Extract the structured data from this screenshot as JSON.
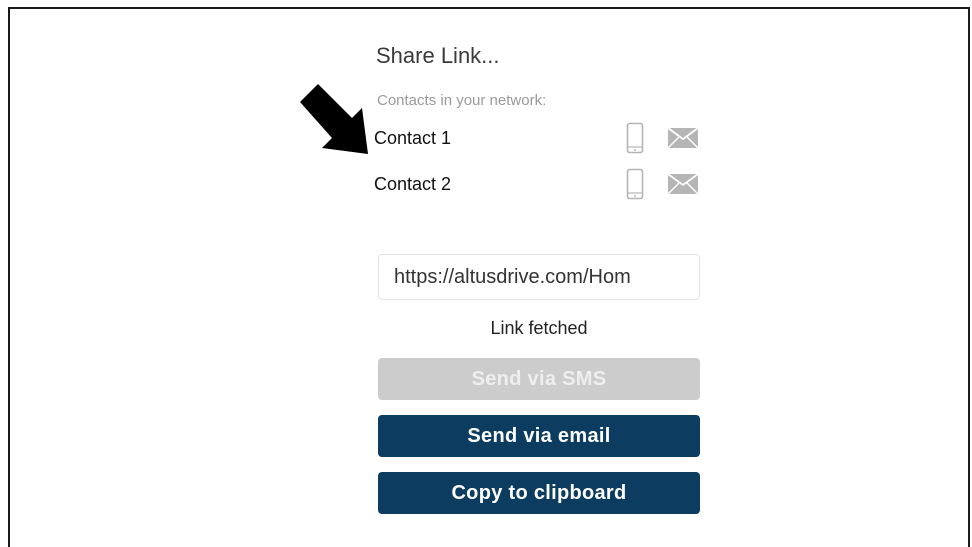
{
  "dialog": {
    "title": "Share Link...",
    "contacts_label": "Contacts in your network:",
    "contacts": [
      {
        "name": "Contact 1"
      },
      {
        "name": "Contact 2"
      }
    ],
    "link_value": "https://altusdrive.com/Hom",
    "status": "Link fetched",
    "buttons": {
      "sms": "Send via SMS",
      "email": "Send via email",
      "copy": "Copy to clipboard"
    }
  },
  "icons": {
    "phone": "mobile-phone-icon",
    "mail": "envelope-icon",
    "annotation": "arrow-icon"
  },
  "colors": {
    "primary_button": "#0c3c60",
    "disabled_button": "#cccccc",
    "icon_gray": "#b5b5b5"
  }
}
